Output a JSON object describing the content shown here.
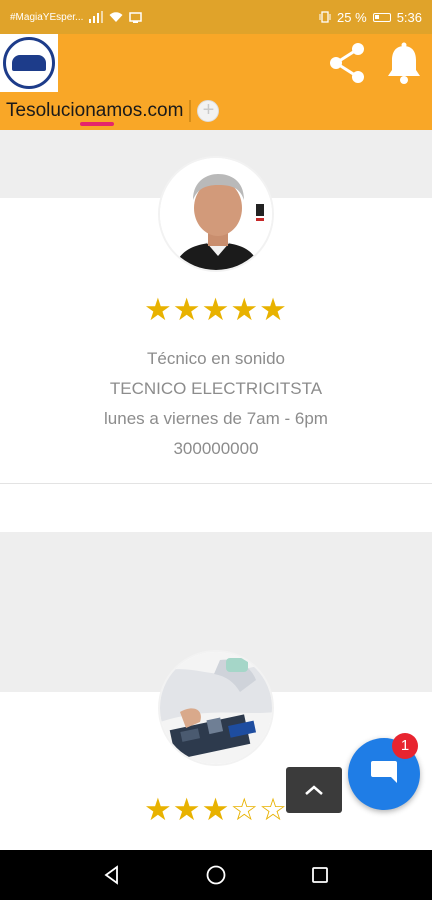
{
  "status_bar": {
    "carrier": "#MagiaYEsper...",
    "battery": "25 %",
    "time": "5:36"
  },
  "app_bar": {
    "tab_label": "Tesolucionamos.com",
    "add_tab_symbol": "+"
  },
  "cards": [
    {
      "avatar_desc": "portrait of technician",
      "rating": 5,
      "stars_text": "★★★★★",
      "profession": "Técnico en sonido",
      "specialty": "TECNICO ELECTRICITSTA",
      "schedule": "lunes a viernes de 7am - 6pm",
      "phone": "300000000"
    },
    {
      "avatar_desc": "electronics repair photo",
      "rating": 3,
      "stars_text_filled": "★★★",
      "stars_text_empty": "☆☆"
    }
  ],
  "chat": {
    "badge_count": "1"
  },
  "colors": {
    "status_bar": "#e0a32a",
    "app_bar": "#f9a727",
    "tab_indicator": "#e5256b",
    "star": "#e8b200",
    "chat_fab": "#1f7de6",
    "badge": "#e8242f"
  },
  "icons": {
    "share": "share-icon",
    "bell": "bell-icon",
    "scroll_top": "chevron-up-icon",
    "chat": "chat-icon",
    "back": "back-icon",
    "home": "home-icon",
    "recents": "recents-icon"
  }
}
